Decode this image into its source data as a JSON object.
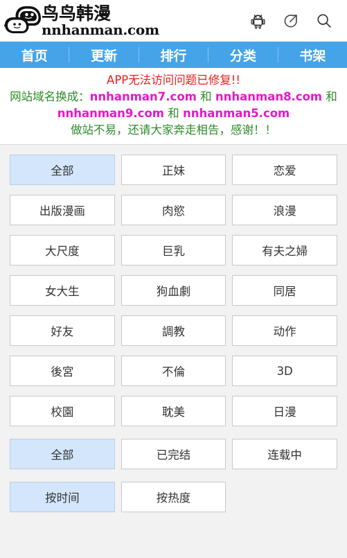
{
  "site": {
    "logo_cn": "鸟鸟韩漫",
    "logo_en": "nnhanman.com"
  },
  "header": {
    "icons": [
      {
        "name": "android-icon",
        "label": "Android"
      },
      {
        "name": "share-external-icon",
        "label": "Share"
      },
      {
        "name": "search-icon",
        "label": "Search"
      }
    ]
  },
  "nav": {
    "items": [
      {
        "label": "首页"
      },
      {
        "label": "更新"
      },
      {
        "label": "排行"
      },
      {
        "label": "分类"
      },
      {
        "label": "书架"
      }
    ]
  },
  "announcement": {
    "line1": "APP无法访问问题已修复!!",
    "line2_prefix": "网站域名换成：",
    "line2_domain1": "nnhanman7.com",
    "line2_and1": " 和 ",
    "line2_domain2": "nnhanman8.com",
    "line2_and2": " 和",
    "line3_domain3": "nnhanman9.com",
    "line3_and3": " 和 ",
    "line3_domain4": "nnhanman5.com",
    "line4": "做站不易，还请大家奔走相告，感谢！！"
  },
  "filters": {
    "categories": [
      {
        "label": "全部",
        "active": true
      },
      {
        "label": "正妹",
        "active": false
      },
      {
        "label": "恋爱",
        "active": false
      },
      {
        "label": "出版漫画",
        "active": false
      },
      {
        "label": "肉慾",
        "active": false
      },
      {
        "label": "浪漫",
        "active": false
      },
      {
        "label": "大尺度",
        "active": false
      },
      {
        "label": "巨乳",
        "active": false
      },
      {
        "label": "有夫之婦",
        "active": false
      },
      {
        "label": "女大生",
        "active": false
      },
      {
        "label": "狗血劇",
        "active": false
      },
      {
        "label": "同居",
        "active": false
      },
      {
        "label": "好友",
        "active": false
      },
      {
        "label": "調教",
        "active": false
      },
      {
        "label": "动作",
        "active": false
      },
      {
        "label": "後宮",
        "active": false
      },
      {
        "label": "不倫",
        "active": false
      },
      {
        "label": "3D",
        "active": false
      },
      {
        "label": "校園",
        "active": false
      },
      {
        "label": "耽美",
        "active": false
      },
      {
        "label": "日漫",
        "active": false
      }
    ],
    "status": [
      {
        "label": "全部",
        "active": true
      },
      {
        "label": "已完结",
        "active": false
      },
      {
        "label": "连载中",
        "active": false
      }
    ],
    "sort": [
      {
        "label": "按时间",
        "active": true
      },
      {
        "label": "按热度",
        "active": false
      }
    ]
  },
  "colors": {
    "nav_blue": "#45a3e8",
    "active_blue": "#d3e6fb",
    "announce_red": "#e8201c",
    "announce_green": "#2f8b2a",
    "announce_pink": "#e618cb",
    "page_bg": "#f2f2f2"
  }
}
